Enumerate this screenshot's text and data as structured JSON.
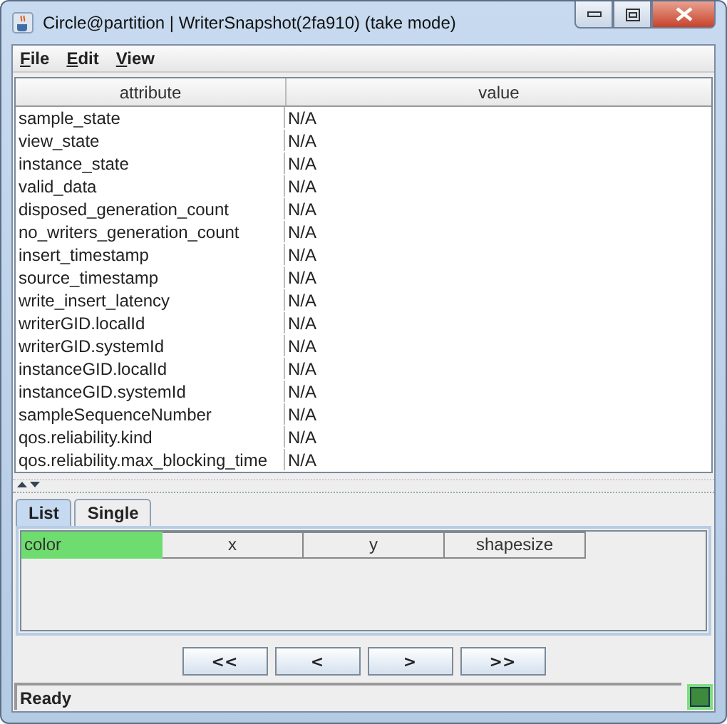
{
  "window": {
    "title": "Circle@partition | WriterSnapshot(2fa910) (take mode)"
  },
  "menu": [
    "File",
    "Edit",
    "View"
  ],
  "table": {
    "columns": [
      "attribute",
      "value"
    ],
    "rows": [
      {
        "attribute": "sample_state",
        "value": "N/A"
      },
      {
        "attribute": "view_state",
        "value": "N/A"
      },
      {
        "attribute": "instance_state",
        "value": "N/A"
      },
      {
        "attribute": "valid_data",
        "value": "N/A"
      },
      {
        "attribute": "disposed_generation_count",
        "value": "N/A"
      },
      {
        "attribute": "no_writers_generation_count",
        "value": "N/A"
      },
      {
        "attribute": "insert_timestamp",
        "value": "N/A"
      },
      {
        "attribute": "source_timestamp",
        "value": "N/A"
      },
      {
        "attribute": "write_insert_latency",
        "value": "N/A"
      },
      {
        "attribute": "writerGID.localId",
        "value": "N/A"
      },
      {
        "attribute": "writerGID.systemId",
        "value": "N/A"
      },
      {
        "attribute": "instanceGID.localId",
        "value": "N/A"
      },
      {
        "attribute": "instanceGID.systemId",
        "value": "N/A"
      },
      {
        "attribute": "sampleSequenceNumber",
        "value": "N/A"
      },
      {
        "attribute": "qos.reliability.kind",
        "value": "N/A"
      },
      {
        "attribute": "qos.reliability.max_blocking_time",
        "value": "N/A"
      }
    ]
  },
  "tabs": [
    {
      "label": "List",
      "selected": true
    },
    {
      "label": "Single",
      "selected": false
    }
  ],
  "list_columns": [
    {
      "label": "color",
      "selected": true
    },
    {
      "label": "x",
      "selected": false
    },
    {
      "label": "y",
      "selected": false
    },
    {
      "label": "shapesize",
      "selected": false
    }
  ],
  "buttons": [
    "<<",
    "<",
    ">",
    ">>"
  ],
  "status_bar": {
    "text": "Ready"
  }
}
